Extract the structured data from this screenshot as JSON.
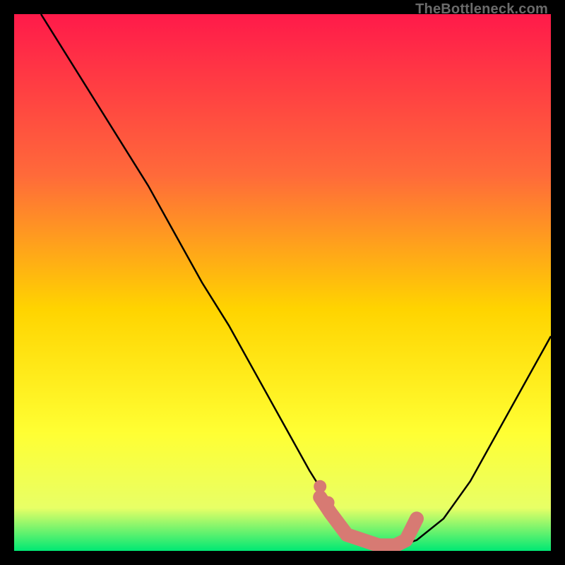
{
  "watermark": "TheBottleneck.com",
  "colors": {
    "black": "#000000",
    "grad_top": "#ff1a4a",
    "grad_mid1": "#ff6a3a",
    "grad_mid2": "#ffd400",
    "grad_mid3": "#ffff33",
    "grad_mid4": "#e8ff66",
    "grad_bottom": "#00e874",
    "curve": "#000000",
    "marker": "#d77a73"
  },
  "chart_data": {
    "type": "line",
    "title": "",
    "xlabel": "",
    "ylabel": "",
    "xlim": [
      0,
      100
    ],
    "ylim": [
      0,
      100
    ],
    "grid": false,
    "legend": false,
    "series": [
      {
        "name": "bottleneck-curve",
        "x": [
          5,
          10,
          15,
          20,
          25,
          30,
          35,
          40,
          45,
          50,
          55,
          60,
          62,
          65,
          70,
          72,
          75,
          80,
          85,
          90,
          95,
          100
        ],
        "y": [
          100,
          92,
          84,
          76,
          68,
          59,
          50,
          42,
          33,
          24,
          15,
          7,
          4,
          2,
          1,
          1,
          2,
          6,
          13,
          22,
          31,
          40
        ]
      }
    ],
    "markers": {
      "name": "highlighted-band",
      "x": [
        57,
        59,
        62,
        65,
        68,
        71,
        73,
        74,
        75
      ],
      "y": [
        10,
        7,
        3,
        2,
        1,
        1,
        2,
        4,
        6
      ]
    },
    "annotations": []
  }
}
